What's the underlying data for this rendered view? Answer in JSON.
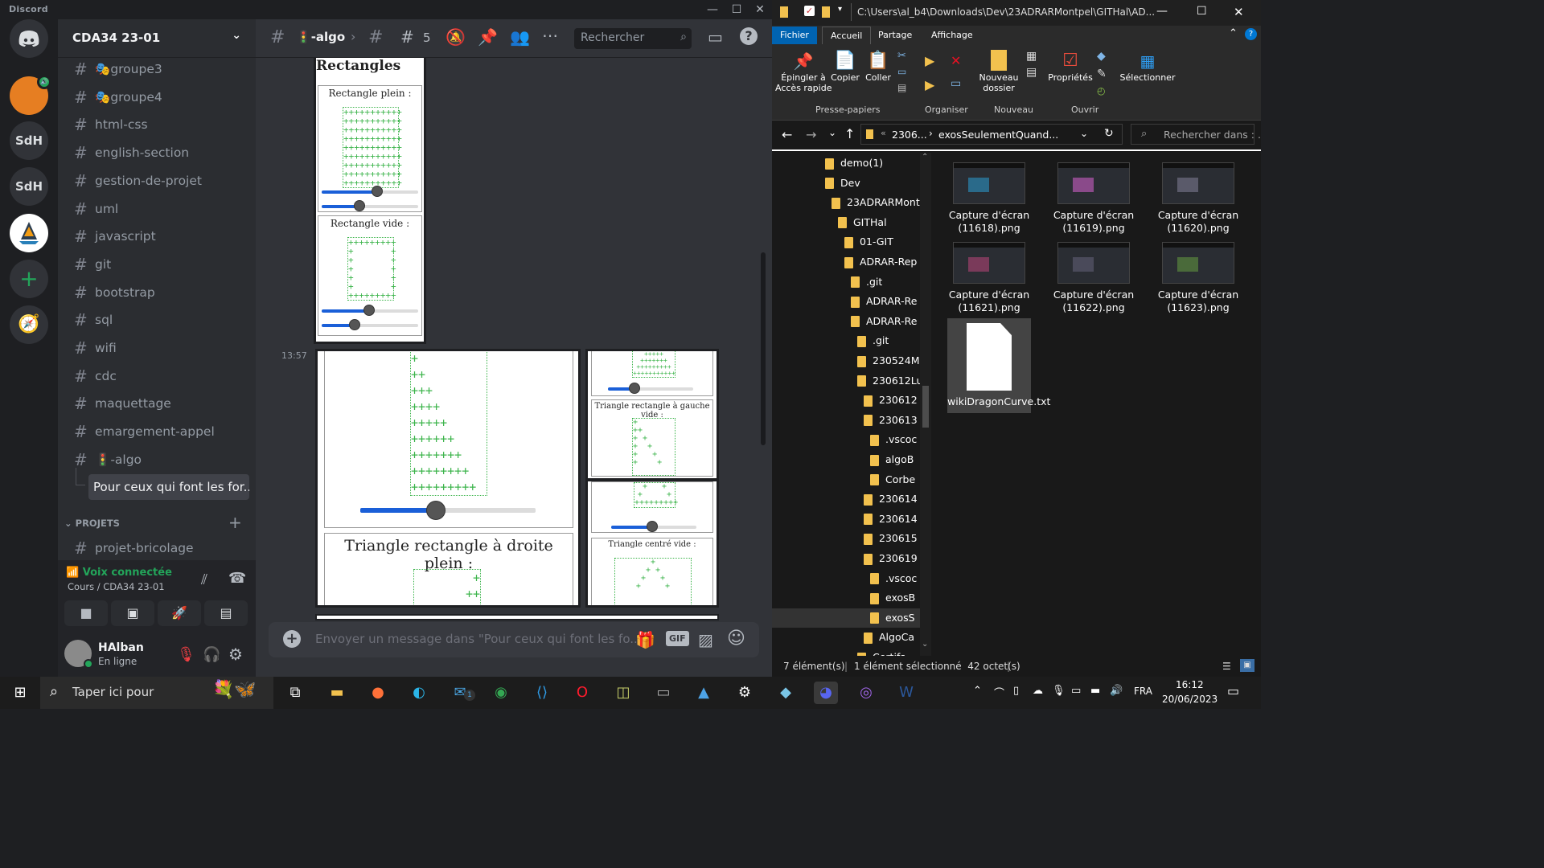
{
  "discord": {
    "app_name": "Discord",
    "server_name": "CDA34 23-01",
    "servers": [
      "SdH",
      "SdH"
    ],
    "channels": [
      {
        "icon": "🎭",
        "name": "groupe3"
      },
      {
        "icon": "🎭",
        "name": "groupe4"
      },
      {
        "icon": "",
        "name": "html-css"
      },
      {
        "icon": "",
        "name": "english-section"
      },
      {
        "icon": "",
        "name": "gestion-de-projet"
      },
      {
        "icon": "",
        "name": "uml"
      },
      {
        "icon": "",
        "name": "javascript"
      },
      {
        "icon": "",
        "name": "git"
      },
      {
        "icon": "",
        "name": "bootstrap"
      },
      {
        "icon": "",
        "name": "sql"
      },
      {
        "icon": "",
        "name": "wifi"
      },
      {
        "icon": "",
        "name": "cdc"
      },
      {
        "icon": "",
        "name": "maquettage"
      },
      {
        "icon": "",
        "name": "emargement-appel"
      },
      {
        "icon": "🚦",
        "name": "-algo"
      }
    ],
    "thread": "Pour ceux qui font les for...",
    "category": "PROJETS",
    "project_channel": "projet-bricolage",
    "voice": {
      "status": "Voix connectée",
      "location": "Cours / CDA34 23-01"
    },
    "user": {
      "name": "HAlban",
      "status": "En ligne"
    },
    "chat": {
      "channel": "-algo",
      "thread_count": "5",
      "search_placeholder": "Rechercher",
      "timestamp": "13:57",
      "composer_placeholder": "Envoyer un message dans \"Pour ceux qui font les fo...",
      "gif_label": "GIF"
    },
    "attachments": {
      "rect_title": "Rectangles",
      "rect_full": "Rectangle plein :",
      "rect_empty": "Rectangle vide :",
      "tri_right_full": "Triangle rectangle à droite plein :",
      "tri_left_empty": "Triangle rectangle à gauche vide :",
      "tri_center_empty": "Triangle centré vide :"
    }
  },
  "explorer": {
    "path": "C:\\Users\\al_b4\\Downloads\\Dev\\23ADRARMontpel\\GITHal\\AD...",
    "tabs": [
      "Fichier",
      "Accueil",
      "Partage",
      "Affichage"
    ],
    "ribbon": {
      "pin": "Épingler à\nAccès rapide",
      "copy": "Copier",
      "paste": "Coller",
      "new_folder": "Nouveau\ndossier",
      "properties": "Propriétés",
      "select": "Sélectionner",
      "groups": [
        "Presse-papiers",
        "Organiser",
        "Nouveau",
        "Ouvrir"
      ]
    },
    "breadcrumb": [
      "2306...",
      "exosSeulementQuand..."
    ],
    "search_placeholder": "Rechercher dans : ...",
    "tree": [
      "demo(1)",
      "Dev",
      "23ADRARMont",
      "GITHal",
      "01-GIT",
      "ADRAR-Rep",
      ".git",
      "ADRAR-Re",
      "ADRAR-Re",
      ".git",
      "230524M",
      "230612Lu",
      "230612",
      "230613",
      ".vscoc",
      "algoB",
      "Corbe",
      "230614",
      "230614",
      "230615",
      "230619",
      ".vscoc",
      "exosB",
      "exosS",
      "AlgoCa",
      "Certifs"
    ],
    "files": [
      {
        "name": "Capture d'écran (11618).png"
      },
      {
        "name": "Capture d'écran (11619).png"
      },
      {
        "name": "Capture d'écran (11620).png"
      },
      {
        "name": "Capture d'écran (11621).png"
      },
      {
        "name": "Capture d'écran (11622).png"
      },
      {
        "name": "Capture d'écran (11623).png"
      },
      {
        "name": "wikiDragonCurve.txt"
      }
    ],
    "status": {
      "count": "7 élément(s)",
      "selected": "1 élément sélectionné  42 octet(s)"
    }
  },
  "taskbar": {
    "search_placeholder": "Taper ici pour",
    "lang": "FRA",
    "time": "16:12",
    "date": "20/06/2023",
    "mail_badge": "1"
  },
  "colors": {
    "accent": "#5865f2",
    "green": "#23a55a",
    "blue": "#1a5fd8",
    "explorer_tab": "#0063b1"
  }
}
